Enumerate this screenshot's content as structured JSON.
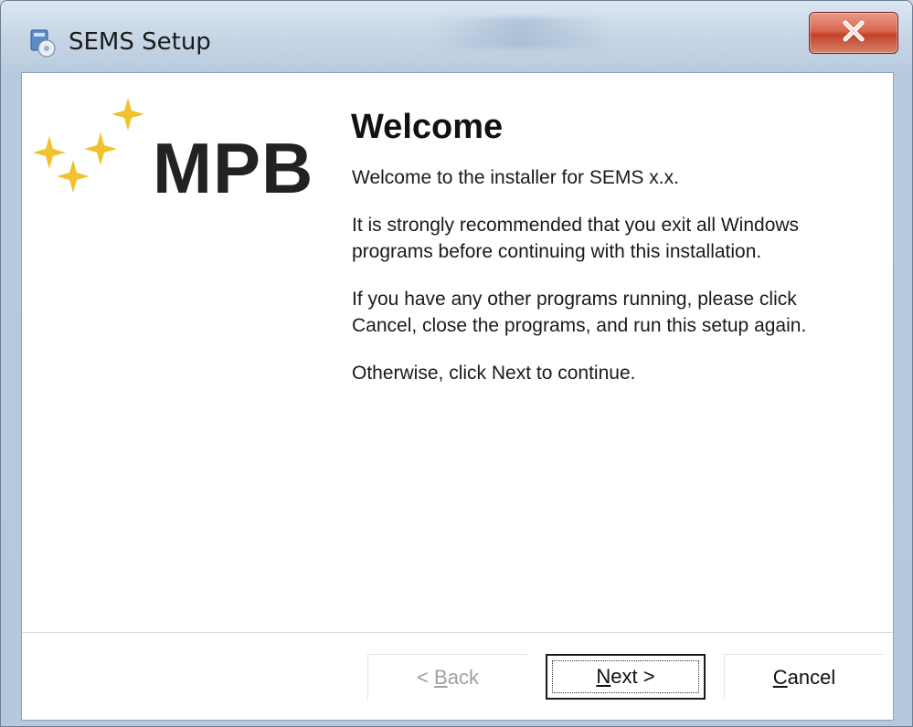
{
  "window": {
    "title": "SEMS Setup",
    "app_icon": "installer-icon",
    "close_icon": "close-icon"
  },
  "logo": {
    "text": "MPB",
    "icon": "sparkles-icon",
    "sparkle_color": "#f2c12e"
  },
  "content": {
    "heading": "Welcome",
    "paragraphs": [
      "Welcome to the installer for SEMS x.x.",
      "It is strongly recommended that you exit all Windows programs before continuing with this installation.",
      "If you have any other programs running, please click Cancel, close the programs, and run this setup again.",
      "Otherwise, click Next to continue."
    ]
  },
  "buttons": {
    "back": {
      "mnemonic_prefix": "< ",
      "mnemonic": "B",
      "rest": "ack",
      "enabled": false
    },
    "next": {
      "mnemonic": "N",
      "rest": "ext >"
    },
    "cancel": {
      "mnemonic": "C",
      "rest": "ancel"
    }
  },
  "colors": {
    "close_button": "#c2412a",
    "disabled_text": "#a0a0a0"
  }
}
